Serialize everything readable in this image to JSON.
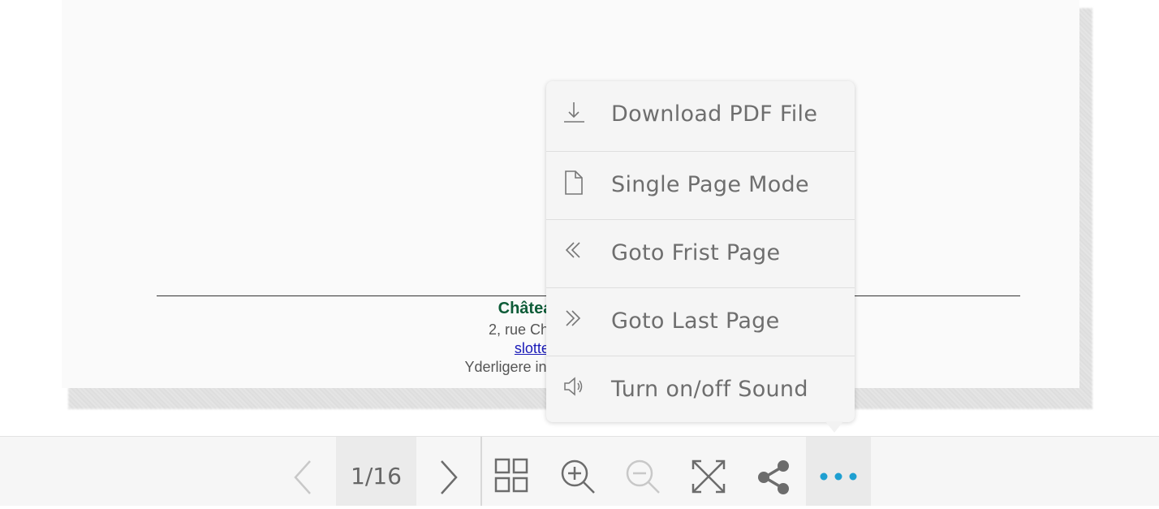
{
  "document_page": {
    "title_partial": "Châtea",
    "address_partial": "2, rue Charles B",
    "email_partial": "slottet@",
    "info_partial": "Yderligere information:"
  },
  "menu": {
    "items": [
      {
        "label": "Download PDF File",
        "icon": "download-icon"
      },
      {
        "label": "Single Page Mode",
        "icon": "single-page-icon"
      },
      {
        "label": "Goto Frist Page",
        "icon": "double-chevron-left-icon"
      },
      {
        "label": "Goto Last Page",
        "icon": "double-chevron-right-icon"
      },
      {
        "label": "Turn on/off Sound",
        "icon": "speaker-icon"
      }
    ]
  },
  "toolbar": {
    "page_indicator": "1/16",
    "buttons": [
      "prev-page",
      "next-page",
      "thumbnails",
      "zoom-in",
      "zoom-out",
      "fullscreen",
      "share",
      "more"
    ],
    "zoom_out_disabled": true,
    "prev_disabled": true,
    "accent_color": "#1e9fd1"
  }
}
